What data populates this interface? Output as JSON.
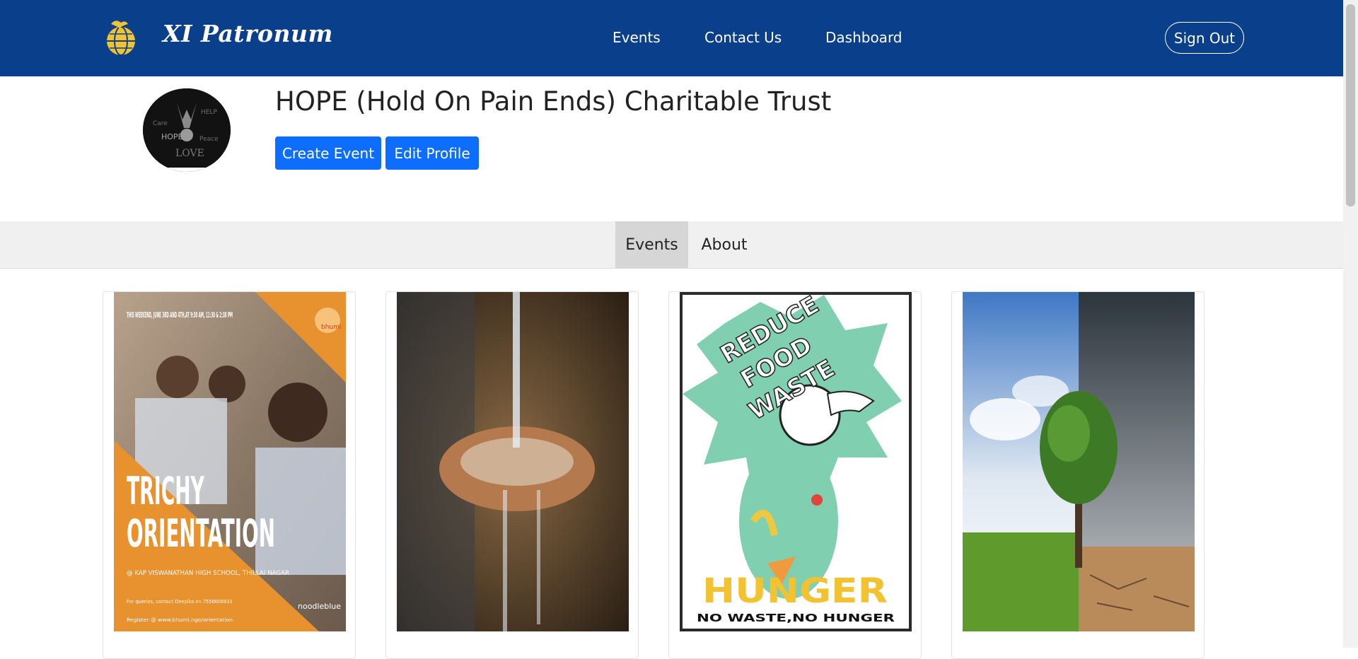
{
  "navbar": {
    "brand": "XI Patronum",
    "links": [
      "Events",
      "Contact Us",
      "Dashboard"
    ],
    "signout_label": "Sign Out"
  },
  "profile": {
    "org_name": "HOPE (Hold On Pain Ends) Charitable Trust",
    "create_event_label": "Create Event",
    "edit_profile_label": "Edit Profile",
    "avatar_words": [
      "Care",
      "HELP",
      "HOPE",
      "Peace",
      "LOVE"
    ]
  },
  "tabs": [
    "Events",
    "About"
  ],
  "events": [
    {
      "header": "THIS WEEKEND, JUNE 3RD AND 4TH,AT 9:30 AM, 11:30 & 2:30 PM",
      "title_line1": "TRICHY",
      "title_line2": "ORIENTATION",
      "venue": "@ KAP VISWANATHAN HIGH SCHOOL, THILLAI NAGAR",
      "contact": "For queries, contact Deepika on 7550008831",
      "register": "Register @ www.bhumi.ngo/orientation",
      "badge": "bhumi",
      "sponsor": "noodleblue"
    },
    {
      "caption": ""
    },
    {
      "line1": "REDUCE",
      "line2": "FOOD",
      "line3": "WASTE",
      "hunger": "HUNGER",
      "tagline": "NO WASTE,NO HUNGER"
    },
    {
      "caption": ""
    }
  ],
  "colors": {
    "navbar": "#0a3f8c",
    "primary": "#0d6efd",
    "tab_active": "#d6d6d6",
    "tabbar": "#f0f0f0"
  }
}
